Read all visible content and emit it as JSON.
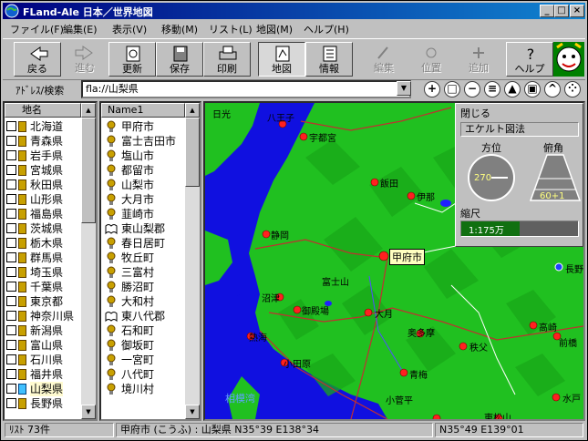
{
  "window": {
    "title": "FLand-Ale 日本／世界地図",
    "buttons": {
      "minimize": "_",
      "maximize": "□",
      "close": "×"
    }
  },
  "menu": [
    "ファイル(F)",
    "編集(E)",
    "表示(V)",
    "移動(M)",
    "リスト(L)",
    "地図(M)",
    "ヘルプ(H)"
  ],
  "toolbar": {
    "back": "戻る",
    "forward": "進む",
    "refresh": "更新",
    "save": "保存",
    "print": "印刷",
    "map": "地図",
    "info": "情報",
    "edit": "編集",
    "position": "位置",
    "add": "追加",
    "help": "ヘルプ"
  },
  "address": {
    "label": "ｱﾄﾞﾚｽ/検索",
    "value": "fla://山梨県"
  },
  "list_left": {
    "header": "地名",
    "items": [
      "北海道",
      "青森県",
      "岩手県",
      "宮城県",
      "秋田県",
      "山形県",
      "福島県",
      "茨城県",
      "栃木県",
      "群馬県",
      "埼玉県",
      "千葉県",
      "東京都",
      "神奈川県",
      "新潟県",
      "富山県",
      "石川県",
      "福井県",
      "山梨県",
      "長野県"
    ],
    "selected": "山梨県"
  },
  "list_right": {
    "header": "Name1",
    "items": [
      {
        "name": "甲府市",
        "icon": "city-icon"
      },
      {
        "name": "富士吉田市",
        "icon": "city-icon"
      },
      {
        "name": "塩山市",
        "icon": "city-icon"
      },
      {
        "name": "都留市",
        "icon": "city-icon"
      },
      {
        "name": "山梨市",
        "icon": "city-icon"
      },
      {
        "name": "大月市",
        "icon": "city-icon"
      },
      {
        "name": "韮崎市",
        "icon": "city-icon"
      },
      {
        "name": "東山梨郡",
        "icon": "district-icon"
      },
      {
        "name": "春日居町",
        "icon": "city-icon"
      },
      {
        "name": "牧丘町",
        "icon": "city-icon"
      },
      {
        "name": "三富村",
        "icon": "city-icon"
      },
      {
        "name": "勝沼町",
        "icon": "city-icon"
      },
      {
        "name": "大和村",
        "icon": "city-icon"
      },
      {
        "name": "東八代郡",
        "icon": "district-icon"
      },
      {
        "name": "石和町",
        "icon": "city-icon"
      },
      {
        "name": "御坂町",
        "icon": "city-icon"
      },
      {
        "name": "一宮町",
        "icon": "city-icon"
      },
      {
        "name": "八代町",
        "icon": "city-icon"
      },
      {
        "name": "境川村",
        "icon": "city-icon"
      }
    ]
  },
  "map": {
    "labels": [
      "八王子",
      "日光",
      "宇都宮",
      "飯田",
      "伊那",
      "静岡",
      "甲府市",
      "富士山",
      "沼津",
      "御殿場",
      "大月",
      "奥多摩",
      "熱海",
      "小田原",
      "秩父",
      "青梅",
      "前橋",
      "高崎",
      "長野",
      "相模湾",
      "小菅平",
      "東松山",
      "水戸"
    ],
    "selected_label": "甲府市"
  },
  "overlay": {
    "close_label": "閉じる",
    "projection": "エケルト図法",
    "bearing_label": "方位",
    "bearing_value": "270",
    "tilt_label": "俯角",
    "tilt_value": "60+1",
    "scale_label": "縮尺",
    "scale_value": "1:175万"
  },
  "status": {
    "count": "ﾘｽﾄ 73件",
    "location": "甲府市 (こうふ) : 山梨県  N35°39 E138°34",
    "cursor": "N35°49 E139°01"
  }
}
